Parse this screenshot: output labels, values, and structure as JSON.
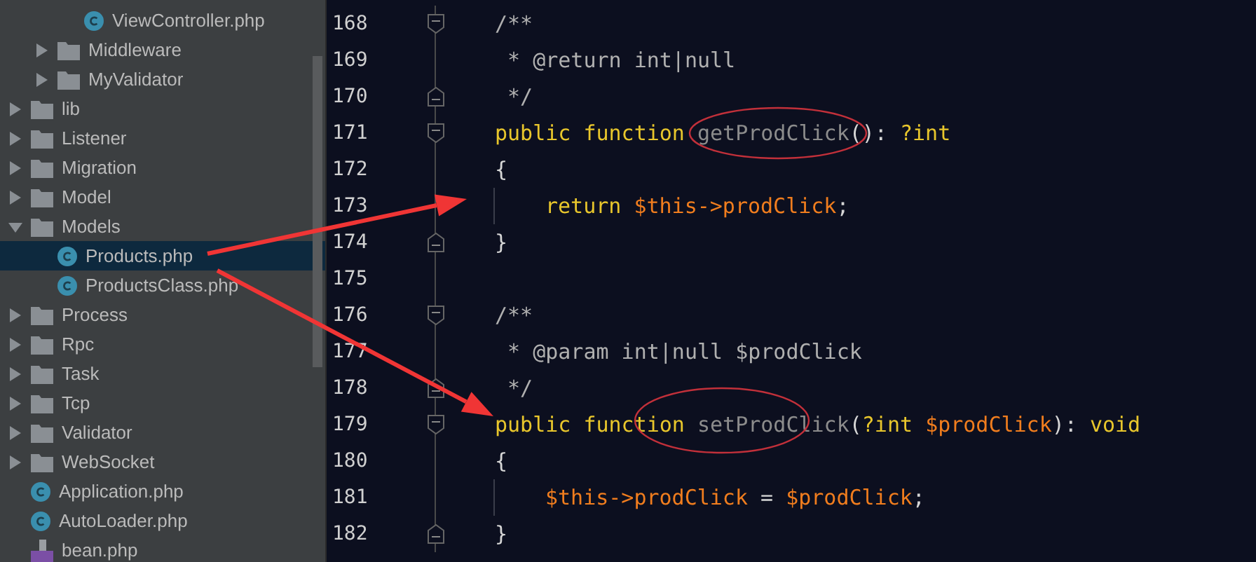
{
  "tree": [
    {
      "children": [
        {
          "children": [
            {
              "kind": "class",
              "name": "ViewController.php",
              "selected": false
            }
          ]
        },
        {
          "kind": "folder",
          "name": "Middleware",
          "expanded": false,
          "selected": false
        },
        {
          "kind": "folder",
          "name": "MyValidator",
          "expanded": false,
          "selected": false
        }
      ]
    },
    {
      "kind": "folder",
      "name": "lib",
      "expanded": false,
      "selected": false
    },
    {
      "kind": "folder",
      "name": "Listener",
      "expanded": false,
      "selected": false
    },
    {
      "kind": "folder",
      "name": "Migration",
      "expanded": false,
      "selected": false
    },
    {
      "kind": "folder",
      "name": "Model",
      "expanded": false,
      "selected": false
    },
    {
      "kind": "folder",
      "name": "Models",
      "expanded": true,
      "selected": false,
      "children": [
        {
          "kind": "class",
          "name": "Products.php",
          "selected": true
        },
        {
          "kind": "class",
          "name": "ProductsClass.php",
          "selected": false
        }
      ]
    },
    {
      "kind": "folder",
      "name": "Process",
      "expanded": false,
      "selected": false
    },
    {
      "kind": "folder",
      "name": "Rpc",
      "expanded": false,
      "selected": false
    },
    {
      "kind": "folder",
      "name": "Task",
      "expanded": false,
      "selected": false
    },
    {
      "kind": "folder",
      "name": "Tcp",
      "expanded": false,
      "selected": false
    },
    {
      "kind": "folder",
      "name": "Validator",
      "expanded": false,
      "selected": false
    },
    {
      "kind": "folder",
      "name": "WebSocket",
      "expanded": false,
      "selected": false
    },
    {
      "kind": "class",
      "name": "Application.php",
      "selected": false
    },
    {
      "kind": "class",
      "name": "AutoLoader.php",
      "selected": false
    },
    {
      "kind": "php",
      "name": "bean.php",
      "selected": false
    }
  ],
  "editor": {
    "lines": [
      {
        "number": "168",
        "fold": {
          "kind": "start"
        },
        "indented": false,
        "tokens": [
          {
            "kind": "comment",
            "t": "/**"
          }
        ]
      },
      {
        "number": "169",
        "indented": false,
        "tokens": [
          {
            "kind": "comment",
            "t": " * @return int|null"
          }
        ]
      },
      {
        "number": "170",
        "fold": {
          "kind": "end"
        },
        "indented": false,
        "tokens": [
          {
            "kind": "comment",
            "t": " */"
          }
        ]
      },
      {
        "number": "171",
        "fold": {
          "kind": "start"
        },
        "indented": false,
        "tokens": [
          {
            "kind": "keyword",
            "t": "public function "
          },
          {
            "kind": "name",
            "t": "getProdClick"
          },
          {
            "kind": "punct",
            "t": "(): "
          },
          {
            "kind": "keyword",
            "t": "?int"
          }
        ]
      },
      {
        "number": "172",
        "indented": false,
        "tokens": [
          {
            "kind": "punct",
            "t": "{"
          }
        ]
      },
      {
        "number": "173",
        "indented": true,
        "tokens": [
          {
            "kind": "keyword",
            "t": "return "
          },
          {
            "kind": "var",
            "t": "$this->prodClick"
          },
          {
            "kind": "punct",
            "t": ";"
          }
        ]
      },
      {
        "number": "174",
        "fold": {
          "kind": "end"
        },
        "indented": false,
        "tokens": [
          {
            "kind": "punct",
            "t": "}"
          }
        ]
      },
      {
        "number": "175",
        "indented": false
      },
      {
        "number": "176",
        "fold": {
          "kind": "start"
        },
        "indented": false,
        "tokens": [
          {
            "kind": "comment",
            "t": "/**"
          }
        ]
      },
      {
        "number": "177",
        "indented": false,
        "tokens": [
          {
            "kind": "comment",
            "t": " * @param int|null $prodClick"
          }
        ]
      },
      {
        "number": "178",
        "fold": {
          "kind": "end"
        },
        "indented": false,
        "tokens": [
          {
            "kind": "comment",
            "t": " */"
          }
        ]
      },
      {
        "number": "179",
        "fold": {
          "kind": "start"
        },
        "indented": false,
        "tokens": [
          {
            "kind": "keyword",
            "t": "public function "
          },
          {
            "kind": "name",
            "t": "setProdClick"
          },
          {
            "kind": "punct",
            "t": "("
          },
          {
            "kind": "keyword",
            "t": "?int "
          },
          {
            "kind": "var",
            "t": "$prodClick"
          },
          {
            "kind": "punct",
            "t": "): "
          },
          {
            "kind": "keyword",
            "t": "void"
          }
        ]
      },
      {
        "number": "180",
        "indented": false,
        "tokens": [
          {
            "kind": "punct",
            "t": "{"
          }
        ]
      },
      {
        "number": "181",
        "indented": true,
        "tokens": [
          {
            "kind": "var",
            "t": "$this->prodClick"
          },
          {
            "kind": "punct",
            "t": " = "
          },
          {
            "kind": "var",
            "t": "$prodClick"
          },
          {
            "kind": "punct",
            "t": ";"
          }
        ]
      },
      {
        "number": "182",
        "fold": {
          "kind": "end"
        },
        "indented": false,
        "tokens": [
          {
            "kind": "punct",
            "t": "}"
          }
        ]
      }
    ]
  }
}
